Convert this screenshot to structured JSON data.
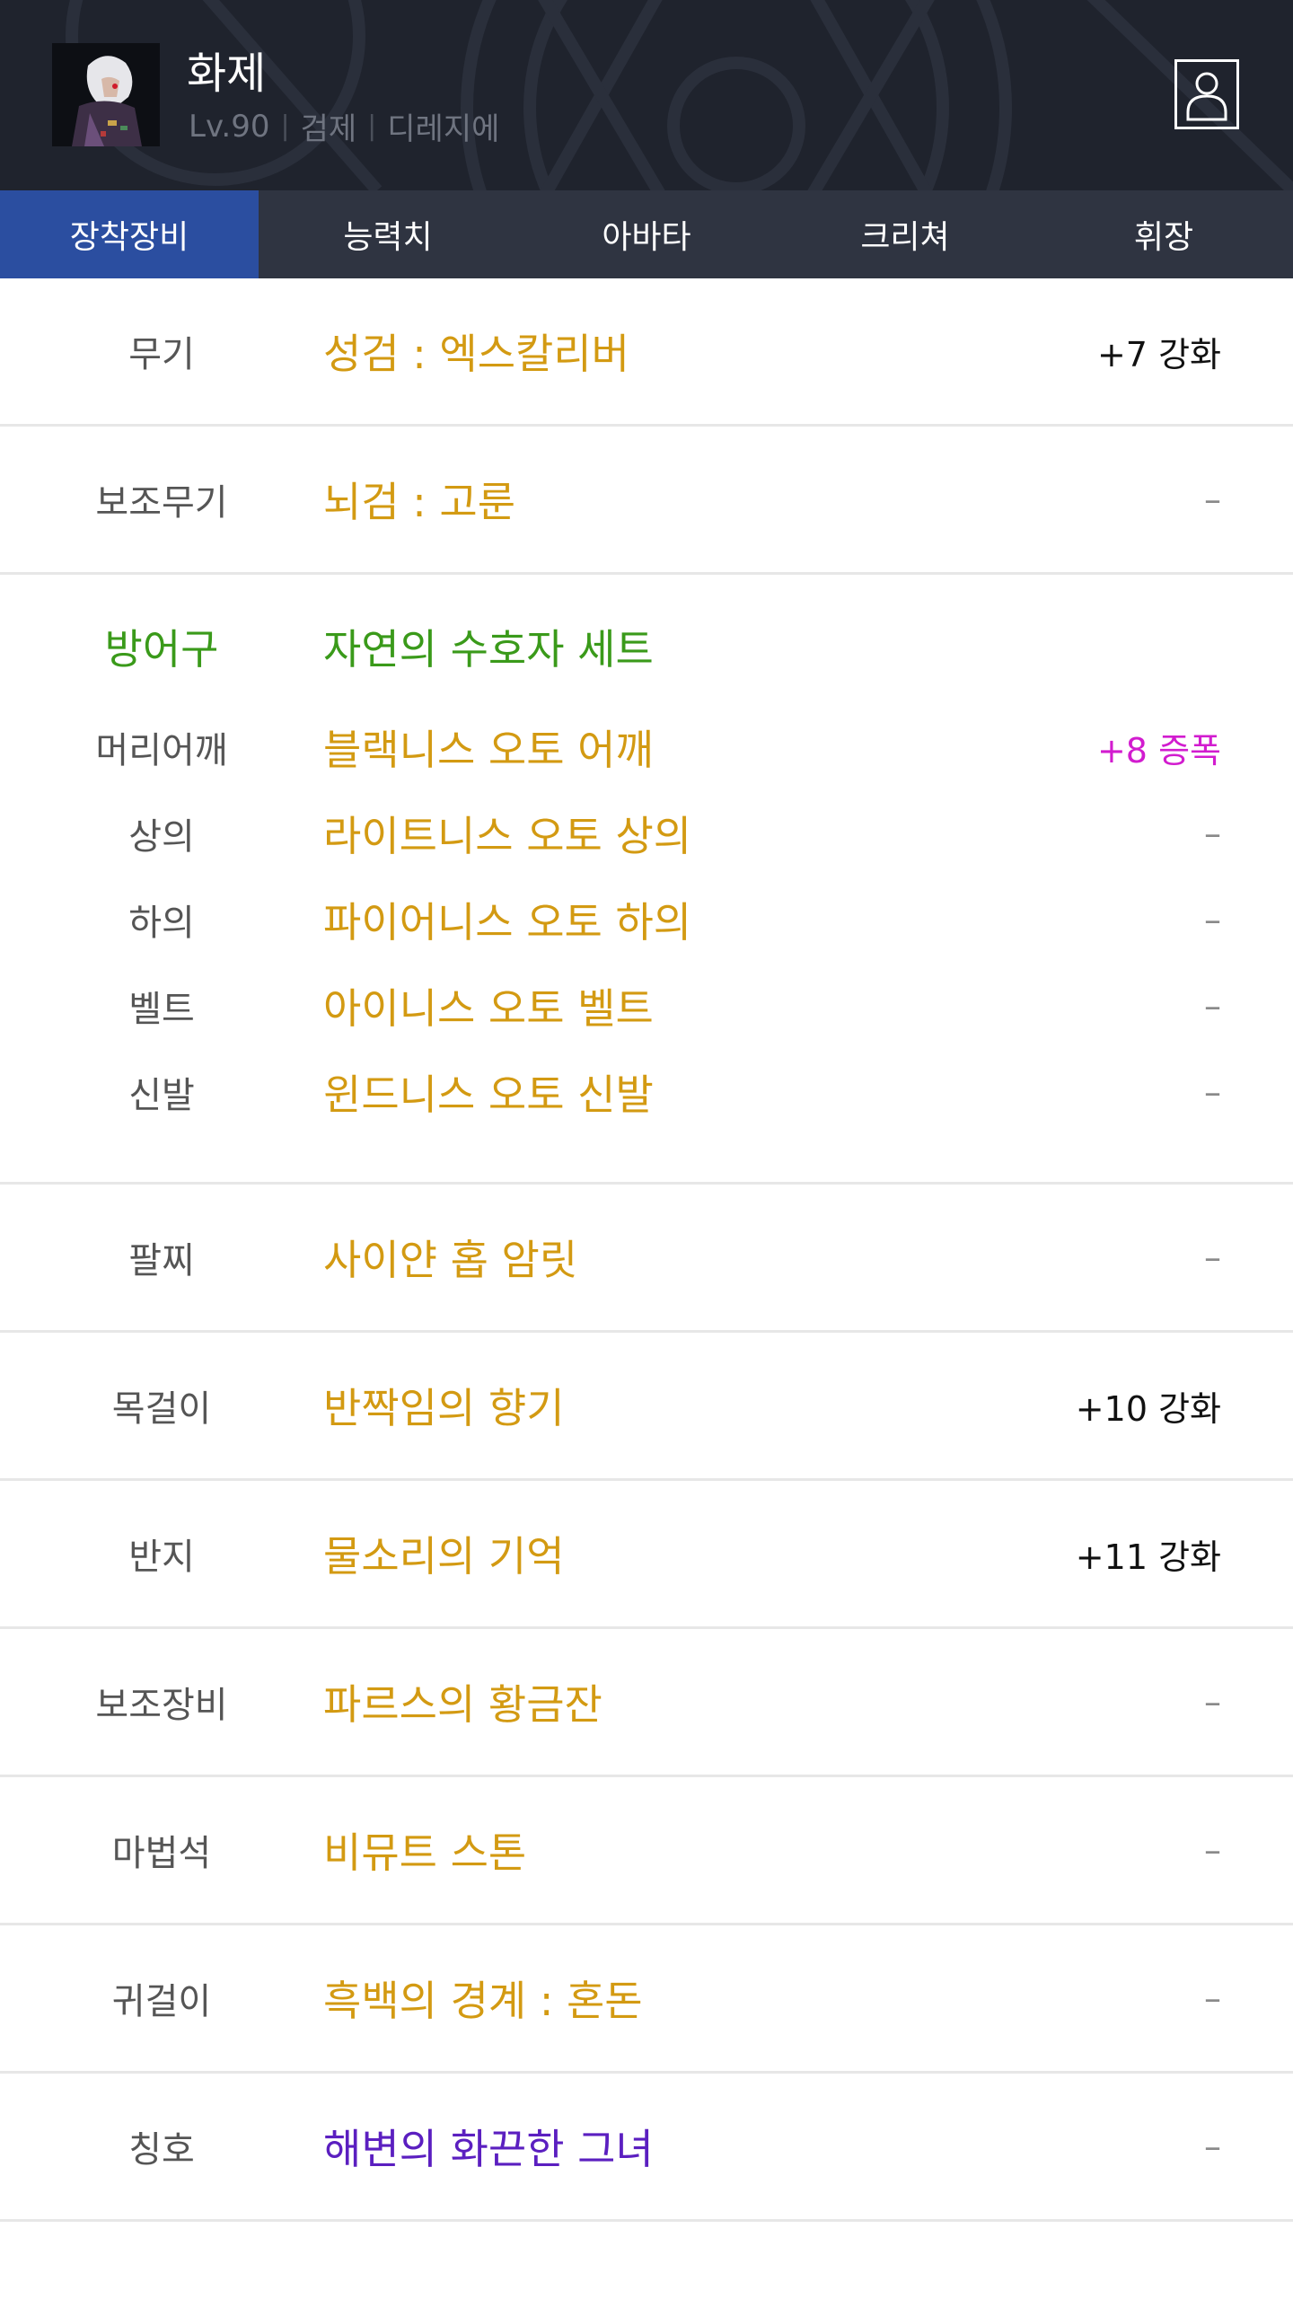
{
  "header": {
    "character_name": "화제",
    "level": "Lv.90",
    "job": "검제",
    "server": "디레지에",
    "profile_icon": "person-icon",
    "avatar_icon": "character-portrait"
  },
  "tabs": [
    {
      "label": "장착장비",
      "active": true
    },
    {
      "label": "능력치",
      "active": false
    },
    {
      "label": "아바타",
      "active": false
    },
    {
      "label": "크리쳐",
      "active": false
    },
    {
      "label": "휘장",
      "active": false
    }
  ],
  "equipment": {
    "weapon": {
      "slot": "무기",
      "name": "성검 : 엑스칼리버",
      "stat": "+7 강화"
    },
    "sub_weapon": {
      "slot": "보조무기",
      "name": "뇌검 : 고룬",
      "stat": "–"
    },
    "armor": {
      "slot": "방어구",
      "set_name": "자연의 수호자 세트",
      "pieces": [
        {
          "slot": "머리어깨",
          "name": "블랙니스 오토 어깨",
          "stat": "+8 증폭"
        },
        {
          "slot": "상의",
          "name": "라이트니스 오토 상의",
          "stat": "–"
        },
        {
          "slot": "하의",
          "name": "파이어니스 오토 하의",
          "stat": "–"
        },
        {
          "slot": "벨트",
          "name": "아이니스 오토 벨트",
          "stat": "–"
        },
        {
          "slot": "신발",
          "name": "윈드니스 오토 신발",
          "stat": "–"
        }
      ]
    },
    "rest": [
      {
        "slot": "팔찌",
        "name": "사이얀 홉 암릿",
        "stat": "–"
      },
      {
        "slot": "목걸이",
        "name": "반짝임의 향기",
        "stat": "+10 강화"
      },
      {
        "slot": "반지",
        "name": "물소리의 기억",
        "stat": "+11 강화"
      },
      {
        "slot": "보조장비",
        "name": "파르스의 황금잔",
        "stat": "–"
      },
      {
        "slot": "마법석",
        "name": "비뮤트 스톤",
        "stat": "–"
      },
      {
        "slot": "귀걸이",
        "name": "흑백의 경계 : 혼돈",
        "stat": "–"
      },
      {
        "slot": "칭호",
        "name": "해변의 화끈한 그녀",
        "stat": "–"
      }
    ]
  },
  "colors": {
    "header_bg": "#1f232d",
    "tab_bg": "#2f3441",
    "tab_active": "#2b4ea0",
    "item_gold": "#d39a12",
    "set_green": "#3a9a1a",
    "title_purple": "#5b1fc0",
    "amplify_magenta": "#d21ccf"
  }
}
